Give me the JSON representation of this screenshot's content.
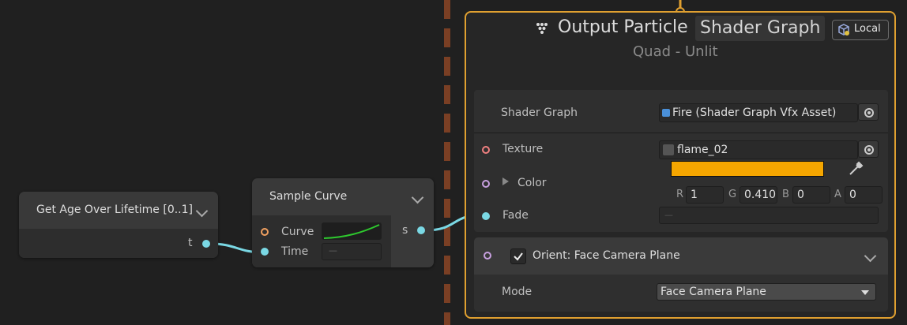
{
  "nodes": {
    "age_node": {
      "title": "Get Age Over Lifetime [0..1]",
      "output": "t"
    },
    "sample_curve": {
      "title": "Sample Curve",
      "in_curve": "Curve",
      "in_time": "Time",
      "output": "s",
      "time_value": "—"
    }
  },
  "context": {
    "title": "Output Particle",
    "shader_graph_pill": "Shader Graph",
    "local_label": "Local",
    "subtitle": "Quad - Unlit",
    "props": {
      "shader_graph_label": "Shader Graph",
      "shader_graph_value": "Fire (Shader Graph Vfx Asset)",
      "texture_label": "Texture",
      "texture_value": "flame_02",
      "color_label": "Color",
      "color_swatch": "#f5a600",
      "r_label": "R",
      "r_value": "1",
      "g_label": "G",
      "g_value": "0.410",
      "b_label": "B",
      "b_value": "0",
      "a_label": "A",
      "a_value": "0",
      "fade_label": "Fade",
      "fade_value": "—"
    },
    "block": {
      "title": "Orient: Face Camera Plane",
      "mode_label": "Mode",
      "mode_value": "Face Camera Plane"
    }
  },
  "colors": {
    "context_border": "#e0a030",
    "port_cyan": "#7ad8e4",
    "port_orange": "#f0a060",
    "port_pink": "#f08080",
    "port_violet": "#c8a0e0",
    "curve_green": "#2ec82e"
  }
}
